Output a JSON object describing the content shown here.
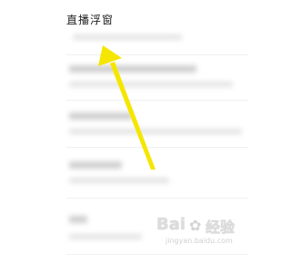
{
  "section": {
    "title": "直播浮窗"
  },
  "watermark": {
    "brand": "Bai",
    "brand_suffix": "经验",
    "domain": "jingyan.baidu.com"
  },
  "annotation": {
    "color": "#f5e600"
  }
}
